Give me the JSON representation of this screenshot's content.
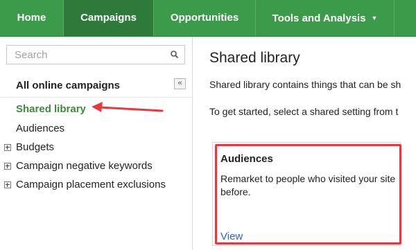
{
  "nav": {
    "tabs": [
      {
        "label": "Home"
      },
      {
        "label": "Campaigns",
        "active": true
      },
      {
        "label": "Opportunities"
      },
      {
        "label": "Tools and Analysis",
        "has_dropdown": true
      }
    ]
  },
  "sidebar": {
    "search_placeholder": "Search",
    "heading": "All online campaigns",
    "collapse_label": "«",
    "items": [
      {
        "label": "Shared library",
        "active": true
      },
      {
        "label": "Audiences"
      },
      {
        "label": "Budgets",
        "expandable": true
      },
      {
        "label": "Campaign negative keywords",
        "expandable": true
      },
      {
        "label": "Campaign placement exclusions",
        "expandable": true
      }
    ]
  },
  "main": {
    "title": "Shared library",
    "description": "Shared library contains things that can be sh",
    "instruction": "To get started, select a shared setting from t",
    "card": {
      "title": "Audiences",
      "text": "Remarket to people who visited your site before.",
      "link": "View"
    }
  },
  "colors": {
    "nav_bg": "#3c9a4b",
    "nav_active": "#2e7a3a",
    "active_link": "#3c8a3c",
    "annotation_red": "#e8383d",
    "link_blue": "#2a64c5"
  }
}
